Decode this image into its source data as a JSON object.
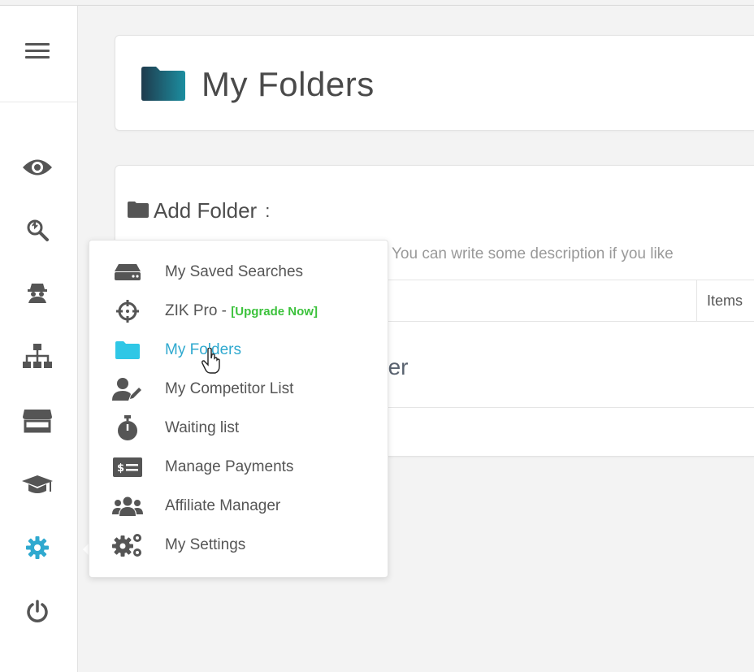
{
  "page": {
    "title": "My Folders"
  },
  "form": {
    "add_folder_label": "Add Folder",
    "colon": ":",
    "description_placeholder": "You can write some description if you like",
    "table_items_header": "Items",
    "row_text_fragment": "der"
  },
  "menu": {
    "items": [
      {
        "label": "My Saved Searches",
        "icon": "hard-drive-icon"
      },
      {
        "label": "ZIK Pro - ",
        "extra": "[Upgrade Now]",
        "icon": "crosshair-icon"
      },
      {
        "label": "My Folders",
        "icon": "folder-icon",
        "active": true
      },
      {
        "label": "My Competitor List",
        "icon": "user-edit-icon"
      },
      {
        "label": "Waiting list",
        "icon": "stopwatch-icon"
      },
      {
        "label": "Manage Payments",
        "icon": "money-bill-icon"
      },
      {
        "label": "Affiliate Manager",
        "icon": "users-icon"
      },
      {
        "label": "My Settings",
        "icon": "cogs-icon"
      }
    ]
  },
  "sidebar": {
    "icons": [
      "menu-icon",
      "eye-icon",
      "search-icon",
      "spy-icon",
      "sitemap-icon",
      "store-icon",
      "graduation-cap-icon",
      "gear-icon",
      "power-icon"
    ],
    "active": "gear-icon"
  },
  "colors": {
    "accent": "#2fa9cf",
    "upgrade": "#3cc23c",
    "folder_gradient_start": "#1f3b4d",
    "folder_gradient_end": "#1c8ea0"
  }
}
